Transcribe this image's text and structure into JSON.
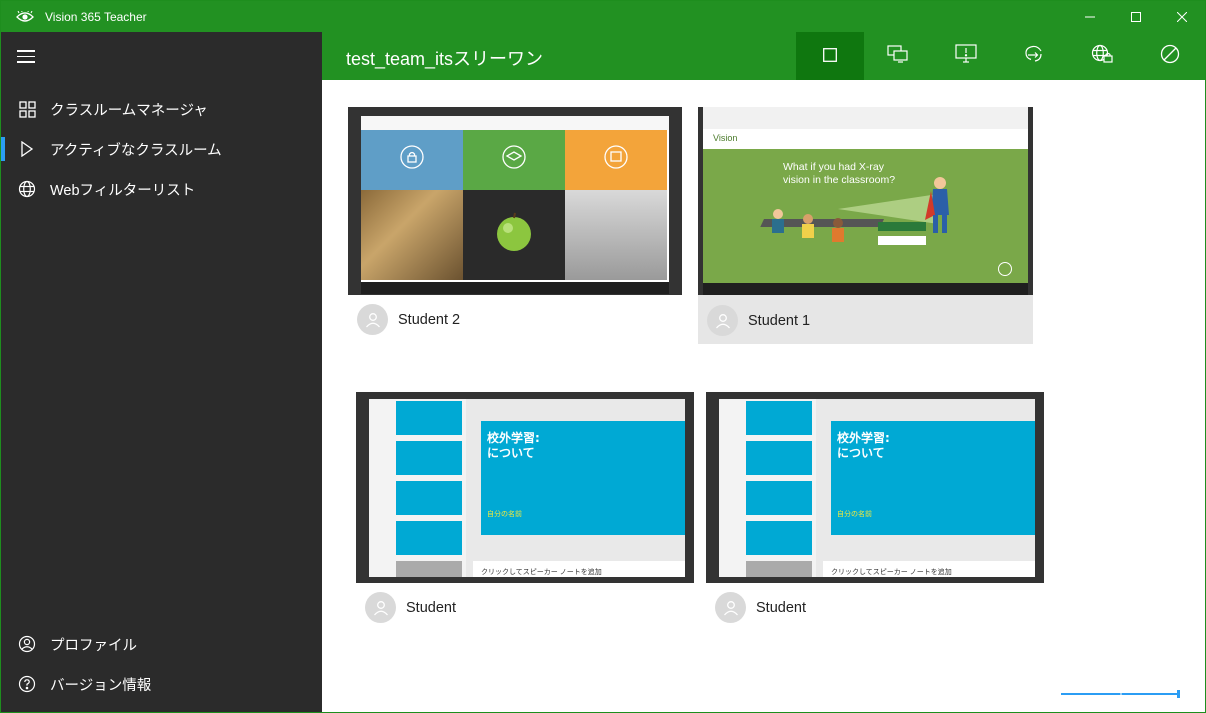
{
  "window": {
    "title": "Vision 365 Teacher",
    "controls": [
      "minimize",
      "maximize",
      "close"
    ]
  },
  "sidebar": {
    "items": [
      {
        "label": "クラスルームマネージャ",
        "icon": "grid-icon"
      },
      {
        "label": "アクティブなクラスルーム",
        "icon": "play-icon",
        "active": true
      },
      {
        "label": "Webフィルターリスト",
        "icon": "globe-icon"
      }
    ],
    "footer": [
      {
        "label": "プロファイル",
        "icon": "profile-icon"
      },
      {
        "label": "バージョン情報",
        "icon": "help-icon"
      }
    ]
  },
  "header": {
    "title": "test_team_itsスリーワン",
    "toolbar": [
      "select-all-icon",
      "share-screen-icon",
      "push-screen-icon",
      "refresh-icon",
      "web-lock-icon",
      "block-icon"
    ]
  },
  "students": [
    {
      "name": "Student 2",
      "screen": "collage"
    },
    {
      "name": "Student 1",
      "screen": "webpage",
      "selected": true
    },
    {
      "name": "Student",
      "screen": "powerpoint"
    },
    {
      "name": "Student",
      "screen": "powerpoint"
    }
  ],
  "screens": {
    "webpage": {
      "logo": "Vision",
      "headline_1": "What if you had X-ray",
      "headline_2": "vision in the classroom?"
    },
    "powerpoint": {
      "slide_title_1": "校外学習:",
      "slide_title_2": "について",
      "slide_subtitle": "自分の名前",
      "notes": "クリックしてスピーカー ノートを追加"
    }
  },
  "colors": {
    "brand_green": "#229122",
    "sidebar_bg": "#2b2b2b",
    "accent_blue": "#2b9df4",
    "slide_blue": "#00a9d4"
  }
}
